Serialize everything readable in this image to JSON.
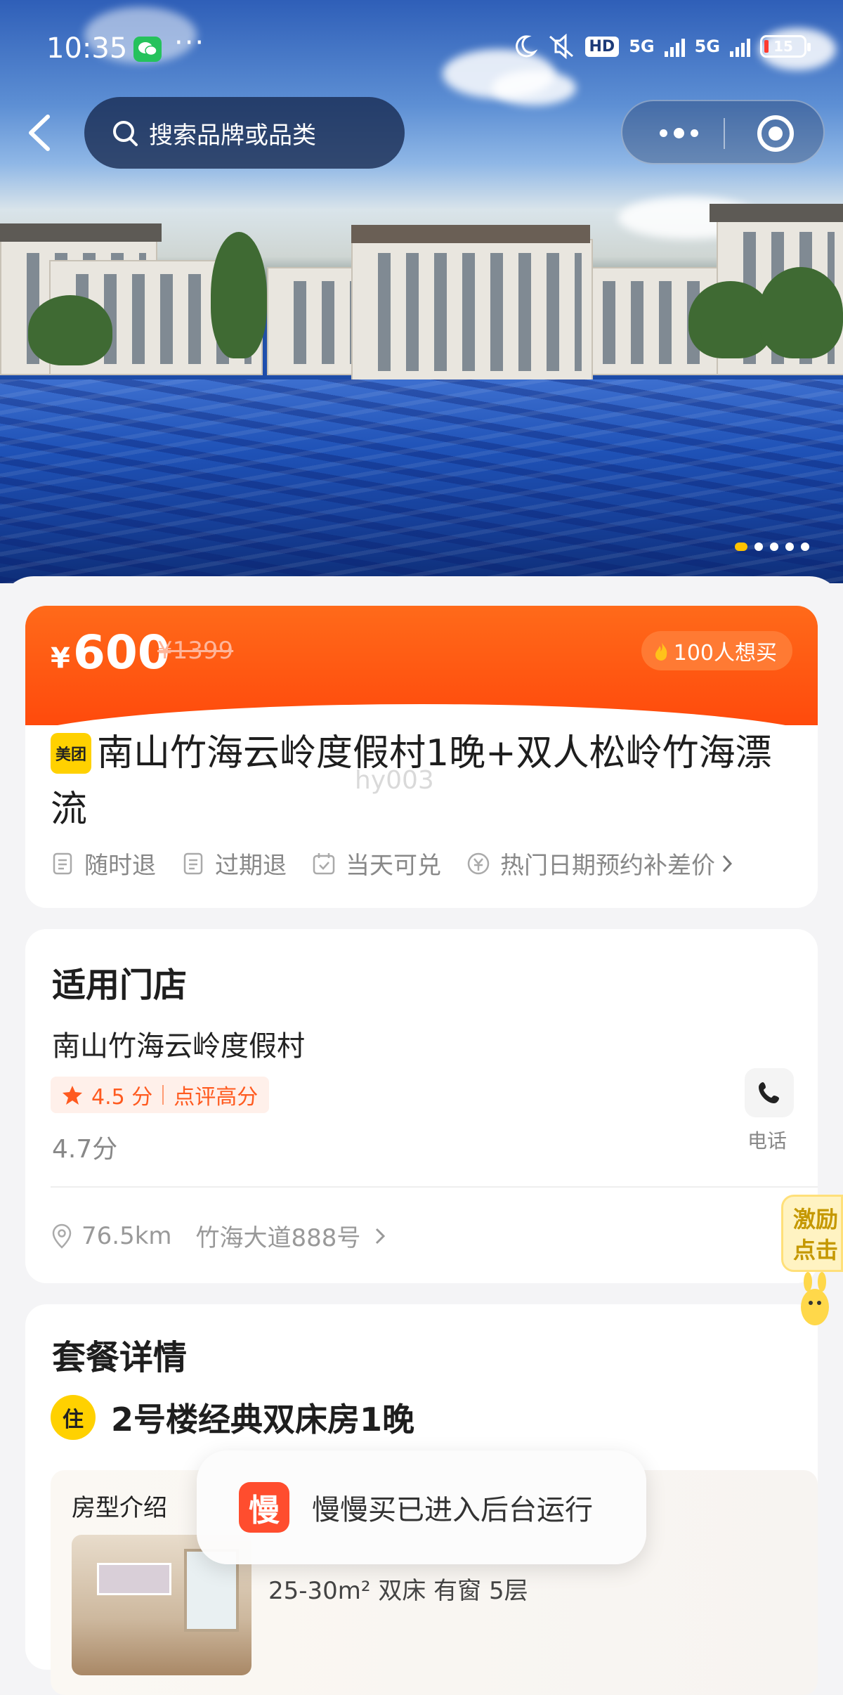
{
  "status_bar": {
    "time": "10:35",
    "more": "···",
    "hd_label": "HD",
    "net1": "5G",
    "net2": "5G",
    "battery": "15",
    "icons": [
      "wechat-icon",
      "moon-icon",
      "mute-icon",
      "hd-icon",
      "signal-icon",
      "battery-icon"
    ]
  },
  "nav": {
    "search_placeholder": "搜索品牌或品类",
    "icons": [
      "back-icon",
      "search-icon",
      "more-icon",
      "target-icon"
    ]
  },
  "hero": {
    "slides_total": 5,
    "active_slide": 1
  },
  "product": {
    "currency": "¥",
    "price": "600",
    "original_price": "¥1399",
    "want_count": "100人想买",
    "badge": "美团",
    "title": "南山竹海云岭度假村1晚+双人松岭竹海漂流",
    "watermark": "hy003",
    "tags": [
      "随时退",
      "过期退",
      "当天可兑",
      "热门日期预约补差价"
    ]
  },
  "store": {
    "section_title": "适用门店",
    "name": "南山竹海云岭度假村",
    "rating": "4.5 分",
    "rating_note": "点评高分",
    "score": "4.7分",
    "phone_label": "电话",
    "distance": "76.5km",
    "address": "竹海大道888号"
  },
  "package": {
    "section_title": "套餐详情",
    "stay_badge": "住",
    "stay_name": "2号楼经典双床房1晚",
    "room_label": "房型介绍",
    "room_spec": "25-30m² 双床 有窗 5层"
  },
  "toast": {
    "app_icon": "慢",
    "text": "慢慢买已进入后台运行"
  },
  "float_widget": {
    "line1": "激励",
    "line2": "点击"
  },
  "colors": {
    "brand_orange": "#ff4a0c",
    "meituan_yellow": "#ffd100",
    "rating_orange": "#ff5a1f"
  }
}
